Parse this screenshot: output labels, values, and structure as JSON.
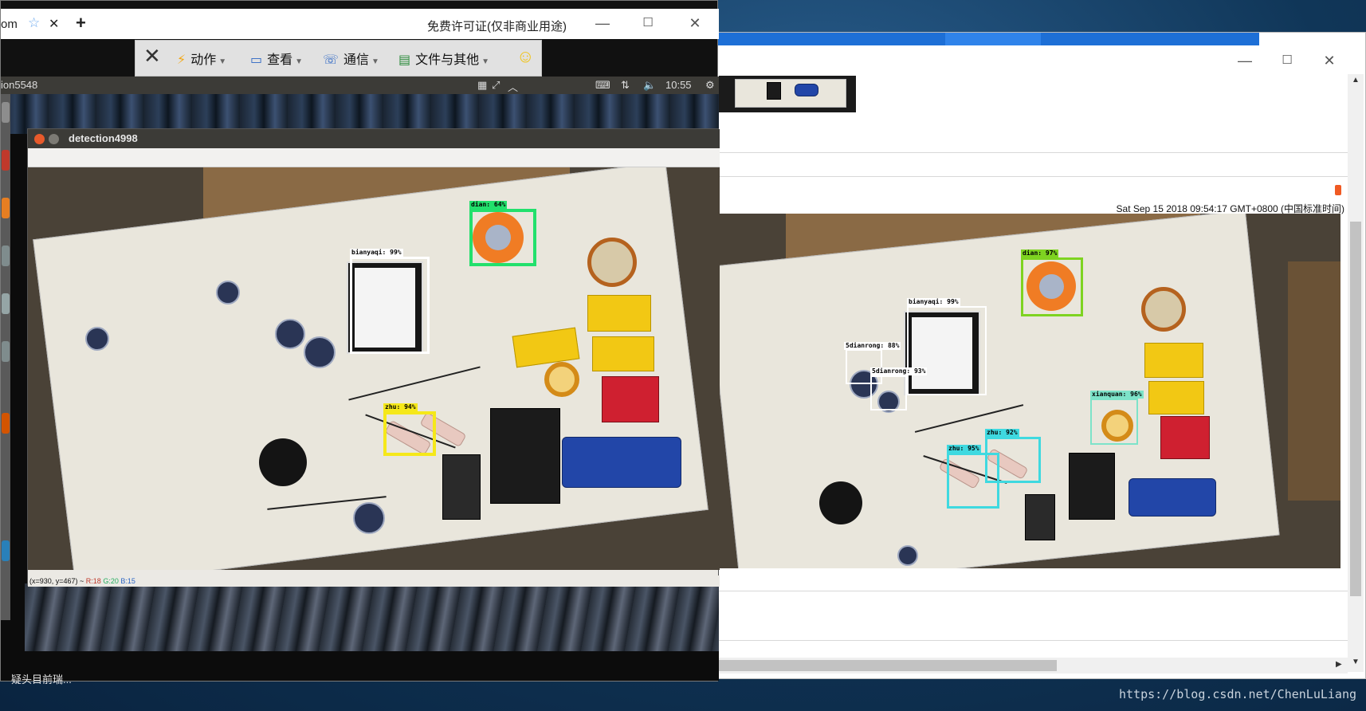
{
  "remote_window": {
    "tab_partial": "om",
    "license_text": "免费许可证(仅非商业用途)",
    "toolbar": {
      "actions": "动作",
      "view": "查看",
      "communication": "通信",
      "files_other": "文件与其他"
    },
    "session": {
      "name": "ion5548",
      "clock": "10:55"
    },
    "detection_window": {
      "title": "detection4998",
      "status_coords": "(x=930, y=467) ~ ",
      "status_r": "R:18",
      "status_g": "G:20",
      "status_b": "B:15",
      "detections": [
        {
          "label": "dian: 64%",
          "color": "#22e06c"
        },
        {
          "label": "bianyaqi: 99%",
          "color": "#ffffff"
        },
        {
          "label": "zhu: 94%",
          "color": "#f5e81a"
        }
      ]
    }
  },
  "browser_window": {
    "timestamp": "Sat Sep 15 2018 09:54:17 GMT+0800 (中国标准时间)",
    "detections": [
      {
        "label": "dian: 97%",
        "color": "#7ed321"
      },
      {
        "label": "bianyaqi: 99%",
        "color": "#ffffff"
      },
      {
        "label": "5dianrong: 88%",
        "color": "#ffffff"
      },
      {
        "label": "5dianrong: 93%",
        "color": "#ffffff"
      },
      {
        "label": "xianquan: 96%",
        "color": "#7de3c9"
      },
      {
        "label": "zhu: 92%",
        "color": "#3fd9e0"
      },
      {
        "label": "zhu: 95%",
        "color": "#3fd9e0"
      }
    ]
  },
  "desktop": {
    "label_partial": "疑头目前瑞...",
    "watermark": "https://blog.csdn.net/ChenLuLiang"
  },
  "colors": {
    "win_accent": "#1d6fd6",
    "ubuntu_close": "#e85a2b"
  }
}
